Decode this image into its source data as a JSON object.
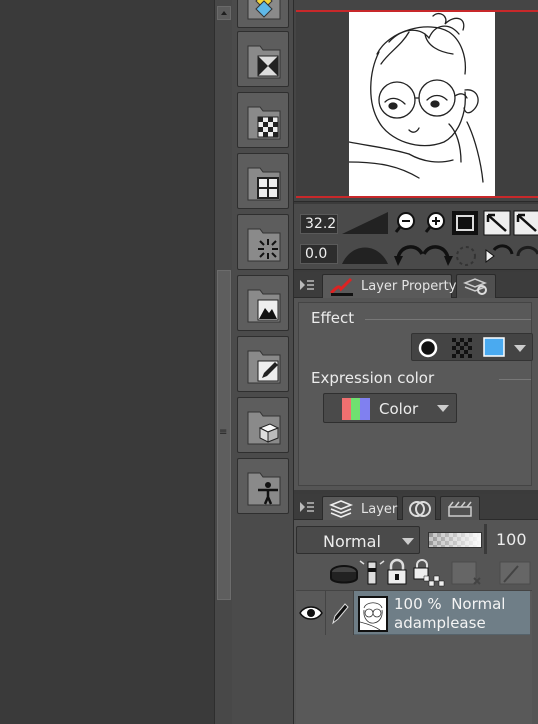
{
  "navigator": {
    "zoom": "32.2",
    "rotation": "0.0"
  },
  "layer_property": {
    "tab_label": "Layer Property",
    "effect_label": "Effect",
    "expression_color_label": "Expression color",
    "expression_color_value": "Color",
    "effect_color": "#4aaaf0"
  },
  "layer_panel": {
    "tab_label": "Layer",
    "blend_mode": "Normal",
    "opacity": "100",
    "layer": {
      "opacity_text": "100 %",
      "blend_text": "Normal",
      "name": "adamplease"
    }
  },
  "colors": {
    "selection_red": "#c8282a",
    "selected_layer_bg": "#6f7e87"
  }
}
